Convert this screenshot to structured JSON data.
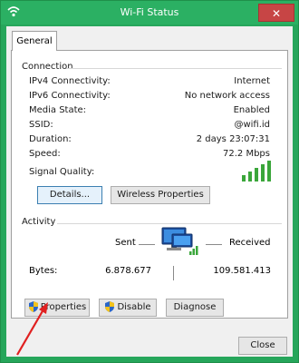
{
  "window": {
    "title": "Wi-Fi Status",
    "close_glyph": "✕"
  },
  "tabs": [
    {
      "label": "General"
    }
  ],
  "connection": {
    "title": "Connection",
    "rows": [
      {
        "label": "IPv4 Connectivity:",
        "value": "Internet"
      },
      {
        "label": "IPv6 Connectivity:",
        "value": "No network access"
      },
      {
        "label": "Media State:",
        "value": "Enabled"
      },
      {
        "label": "SSID:",
        "value": "@wifi.id"
      },
      {
        "label": "Duration:",
        "value": "2 days 23:07:31"
      },
      {
        "label": "Speed:",
        "value": "72.2 Mbps"
      }
    ],
    "signal_label": "Signal Quality:",
    "signal_bars": {
      "filled": 5,
      "total": 5
    },
    "details_button": "Details...",
    "wireless_button": "Wireless Properties"
  },
  "activity": {
    "title": "Activity",
    "sent_label": "Sent",
    "received_label": "Received",
    "bytes_label": "Bytes:",
    "bytes_sent": "6.878.677",
    "bytes_received": "109.581.413"
  },
  "buttons": {
    "properties": "Properties",
    "disable": "Disable",
    "diagnose": "Diagnose",
    "close": "Close"
  },
  "icons": {
    "app": "wifi-icon",
    "shield": "shield-icon",
    "network": "network-computer-icon",
    "signal": "signal-bars-icon",
    "annotation": "red-arrow-icon"
  },
  "colors": {
    "titlebar": "#2bb063",
    "frame": "#26a65b",
    "signal": "#3aa63a",
    "annotation": "#e02020"
  }
}
